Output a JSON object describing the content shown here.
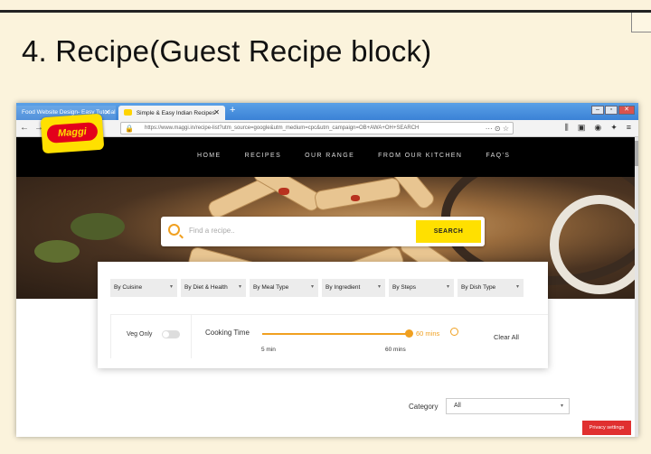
{
  "slide": {
    "title": "4.  Recipe(Guest Recipe block)"
  },
  "browser": {
    "tabs": [
      {
        "label": "Food Website Design- Easy Tutorial",
        "close": "✕"
      },
      {
        "label": "Simple & Easy Indian Recipes",
        "close": "✕"
      }
    ],
    "new_tab": "+",
    "url": "https://www.maggi.in/recipe-list?utm_source=google&utm_medium=cpc&utm_campaign=OB+AWA+OH+SEARCH",
    "url_more": "··· ⊙ ☆"
  },
  "site": {
    "logo_text": "Maggi",
    "menu": [
      "HOME",
      "RECIPES",
      "OUR RANGE",
      "FROM OUR KITCHEN",
      "FAQ'S"
    ],
    "search": {
      "placeholder": "Find a recipe..",
      "button": "SEARCH"
    },
    "filters": [
      "By Cuisine",
      "By Diet & Health",
      "By Meal Type",
      "By Ingredient",
      "By Steps",
      "By Dish Type"
    ],
    "veg_only": "Veg Only",
    "cooking_time": {
      "label": "Cooking Time",
      "value": "60 mins",
      "min": "5 min",
      "max": "60 mins"
    },
    "clear_all": "Clear All",
    "category": {
      "label": "Category",
      "value": "All"
    },
    "privacy": "Privacy settings"
  }
}
